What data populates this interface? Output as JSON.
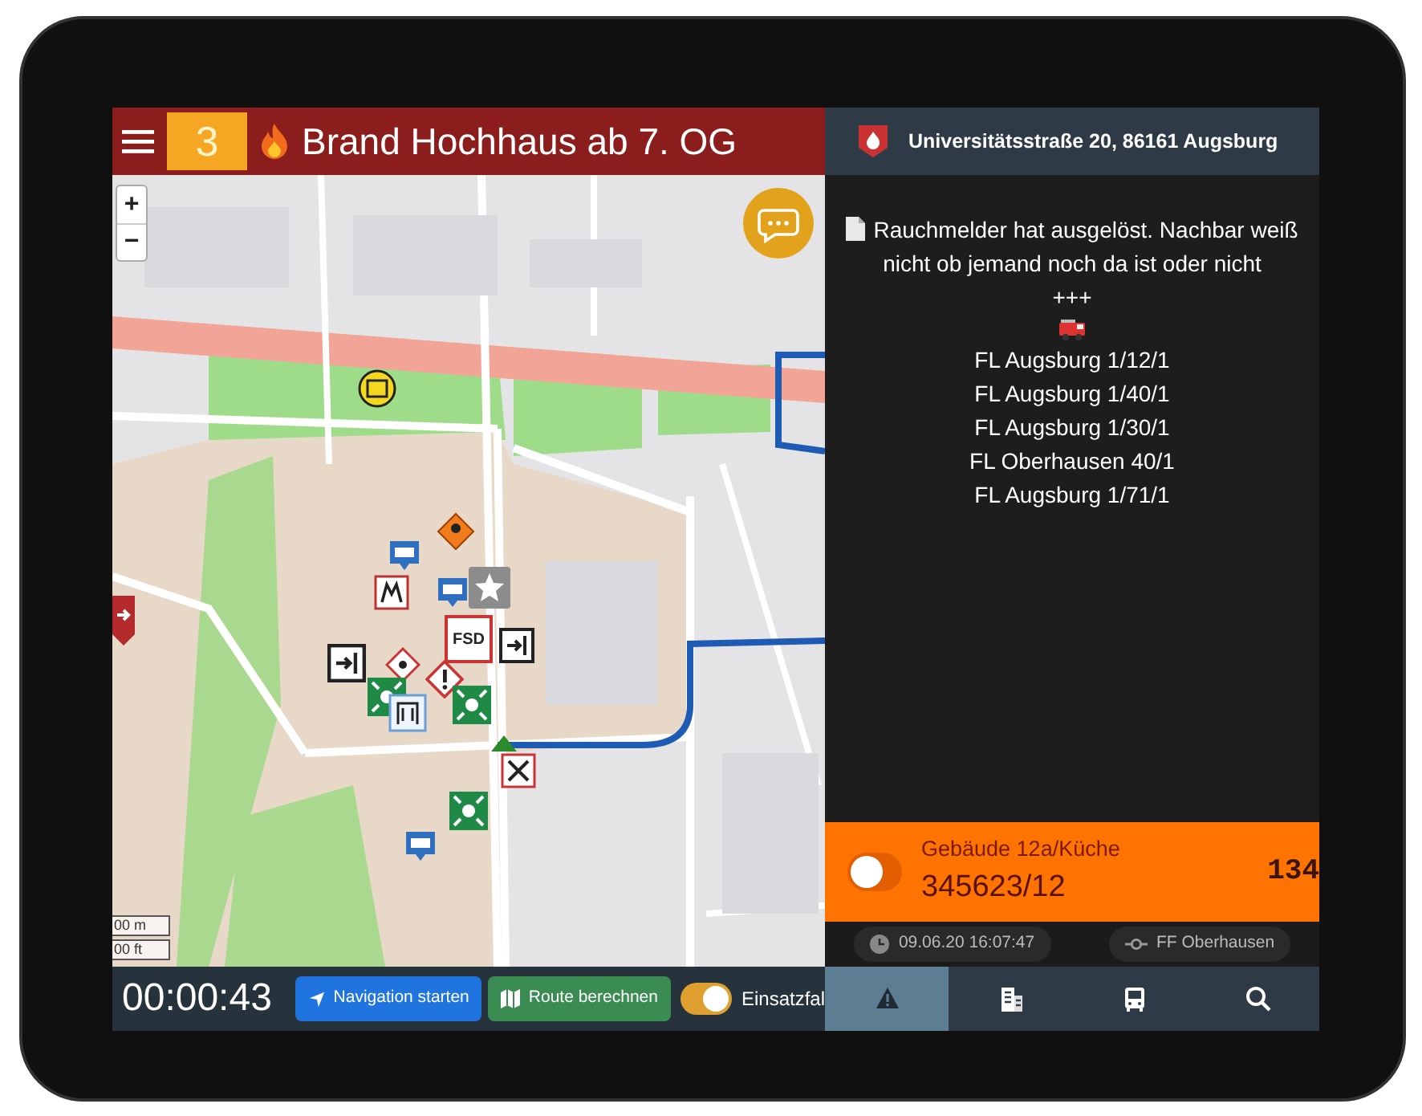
{
  "top_bar": {
    "alarm_level": "3",
    "title": "Brand Hochhaus ab 7. OG"
  },
  "map": {
    "zoom_in": "+",
    "zoom_out": "−",
    "marker_label": "FSD",
    "scale": [
      "00 m",
      "00 ft"
    ]
  },
  "bottom_bar": {
    "timer": "00:00:43",
    "buttons": [
      {
        "label": "Navigation starten",
        "kind": "navigate"
      },
      {
        "label": "Route berechnen",
        "kind": "route"
      }
    ],
    "toggle": {
      "label": "Einsatzfal",
      "on": true
    }
  },
  "side_panel": {
    "address": "Universitätsstraße 20, 86161 Augsburg",
    "message": "Rauchmelder hat ausgelöst. Nachbar weiß nicht ob jemand noch da ist oder nicht",
    "separator": "+++",
    "units": [
      "FL Augsburg 1/12/1",
      "FL Augsburg 1/40/1",
      "FL Augsburg 1/30/1",
      "FL Oberhausen 40/1",
      "FL Augsburg 1/71/1"
    ],
    "alert": {
      "location": "Gebäude 12a/Küche",
      "number": "345623/12",
      "code": "134",
      "on": false
    },
    "time": "09.06.20 16:07:47",
    "station": "FF Oberhausen",
    "tabs": [
      {
        "kind": "warning",
        "selected": true
      },
      {
        "kind": "building",
        "selected": false
      },
      {
        "kind": "bus",
        "selected": false
      },
      {
        "kind": "search",
        "selected": false
      }
    ]
  }
}
